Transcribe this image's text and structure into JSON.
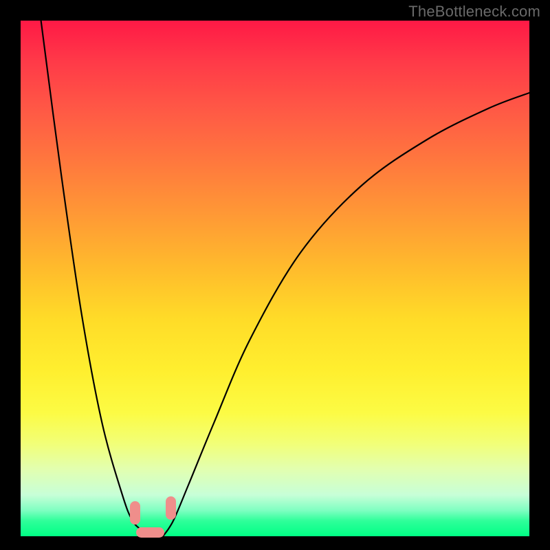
{
  "watermark": "TheBottleneck.com",
  "chart_data": {
    "type": "line",
    "title": "",
    "xlabel": "",
    "ylabel": "",
    "xlim": [
      0,
      100
    ],
    "ylim": [
      0,
      100
    ],
    "grid": false,
    "legend": false,
    "series": [
      {
        "name": "left-curve",
        "x": [
          4,
          8,
          12,
          16,
          20,
          22,
          24,
          25
        ],
        "y": [
          100,
          70,
          43,
          22,
          8,
          3,
          1,
          0
        ]
      },
      {
        "name": "right-curve",
        "x": [
          28,
          30,
          33,
          38,
          45,
          55,
          67,
          80,
          92,
          100
        ],
        "y": [
          0,
          3,
          10,
          22,
          38,
          55,
          68,
          77,
          83,
          86
        ]
      }
    ],
    "markers": [
      {
        "name": "blob-left",
        "x": 22.5,
        "y": 4.5,
        "w": 2.0,
        "h": 4.5
      },
      {
        "name": "blob-right",
        "x": 29.5,
        "y": 5.5,
        "w": 2.0,
        "h": 4.5
      },
      {
        "name": "blob-bottom",
        "x": 25.5,
        "y": 0.8,
        "w": 5.5,
        "h": 2.0
      }
    ],
    "background_gradient": {
      "top": "#ff1946",
      "middle": "#ffdc28",
      "bottom": "#00ff85"
    }
  }
}
